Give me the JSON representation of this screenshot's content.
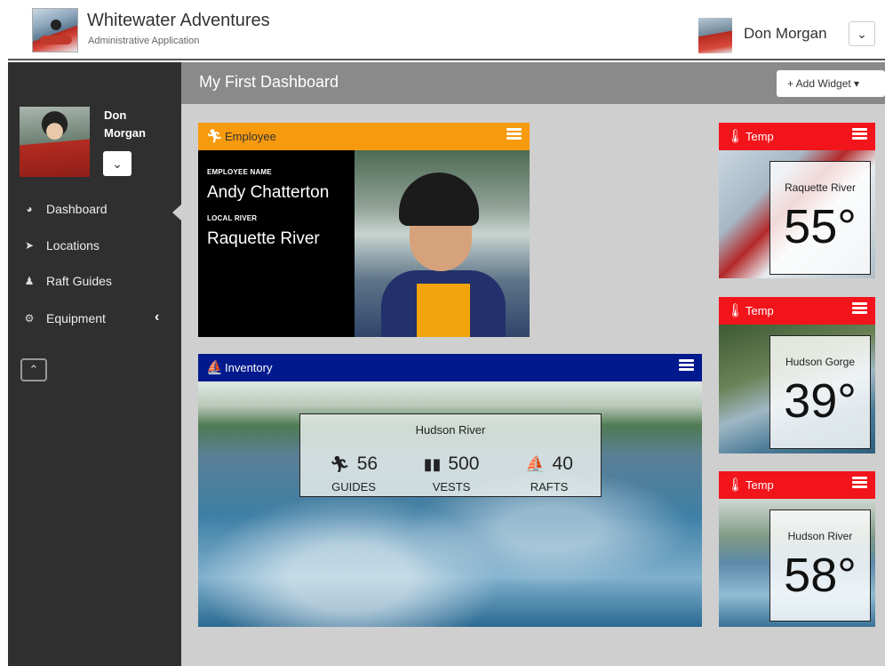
{
  "app": {
    "title": "Whitewater Adventures",
    "subtitle": "Administrative Application"
  },
  "header": {
    "user_name": "Don Morgan",
    "dropdown_icon": "chevron-down-icon"
  },
  "sidebar": {
    "user_name": "Don Morgan",
    "items": [
      {
        "label": "Dashboard",
        "icon": "dashboard-icon",
        "active": true
      },
      {
        "label": "Locations",
        "icon": "location-arrow-icon"
      },
      {
        "label": "Raft Guides",
        "icon": "user-icon"
      },
      {
        "label": "Equipment",
        "icon": "gears-icon",
        "expandable": true
      }
    ]
  },
  "page": {
    "title": "My First Dashboard",
    "add_widget_label": "+ Add Widget ▾"
  },
  "widgets": {
    "employee": {
      "title": "Employee",
      "name_label": "EMPLOYEE NAME",
      "name": "Andy Chatterton",
      "river_label": "LOCAL RIVER",
      "river": "Raquette River",
      "header_color": "#f79a0e"
    },
    "inventory": {
      "title": "Inventory",
      "river": "Hudson River",
      "header_color": "#001a8e",
      "stats": [
        {
          "value": "56",
          "label": "GUIDES",
          "icon": "hiking-icon"
        },
        {
          "value": "500",
          "label": "VESTS",
          "icon": "life-vest-icon"
        },
        {
          "value": "40",
          "label": "RAFTS",
          "icon": "raft-icon"
        }
      ]
    },
    "temps": [
      {
        "title": "Temp",
        "river": "Raquette River",
        "value": "55°"
      },
      {
        "title": "Temp",
        "river": "Hudson Gorge",
        "value": "39°"
      },
      {
        "title": "Temp",
        "river": "Hudson River",
        "value": "58°"
      }
    ],
    "temp_header_color": "#f2141b"
  }
}
